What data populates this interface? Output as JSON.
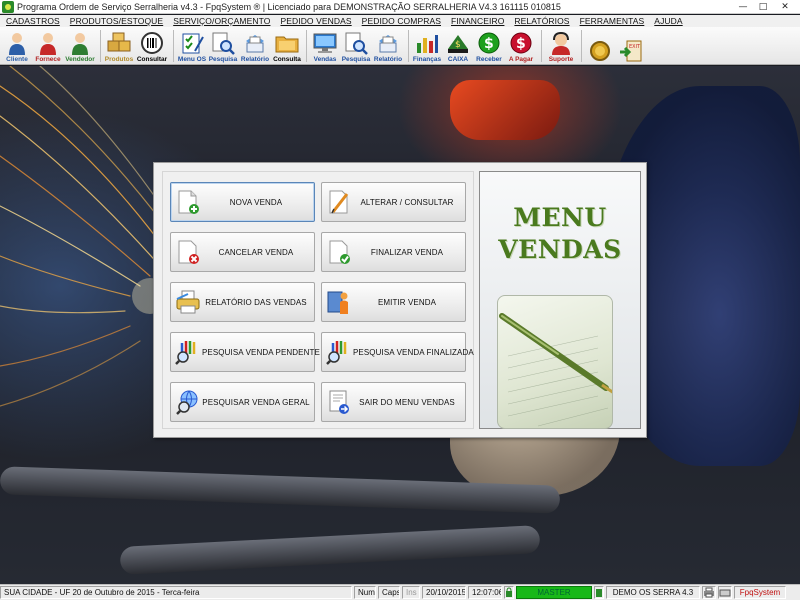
{
  "window": {
    "title": "Programa Ordem de Serviço Serralheria v4.3 - FpqSystem ® | Licenciado para  DEMONSTRAÇÃO SERRALHERIA V4.3 161115 010815",
    "minimize": "—",
    "maximize": "□",
    "close": "✕"
  },
  "menubar": {
    "items": [
      "CADASTROS",
      "PRODUTOS/ESTOQUE",
      "SERVIÇO/ORÇAMENTO",
      "PEDIDO VENDAS",
      "PEDIDO COMPRAS",
      "FINANCEIRO",
      "RELATÓRIOS",
      "FERRAMENTAS",
      "AJUDA"
    ]
  },
  "toolbar": {
    "items": [
      {
        "label": "Cliente",
        "icon": "person-icon",
        "color": "#2d5fa8"
      },
      {
        "label": "Fornece",
        "icon": "person-red-icon",
        "color": "#b22222"
      },
      {
        "label": "Vendedor",
        "icon": "person-green-icon",
        "color": "#2e7d32"
      },
      {
        "label": "Produtos",
        "icon": "boxes-icon",
        "color": "#c8a040"
      },
      {
        "label": "Consultar",
        "icon": "barcode-icon",
        "color": "#000000"
      },
      {
        "label": "Menu OS",
        "icon": "checklist-icon",
        "color": "#1f4fa0"
      },
      {
        "label": "Pesquisa",
        "icon": "search-doc-icon",
        "color": "#1f4fa0"
      },
      {
        "label": "Relatório",
        "icon": "report-icon",
        "color": "#1f4fa0"
      },
      {
        "label": "Consulta",
        "icon": "folder-icon",
        "color": "#000000"
      },
      {
        "label": "Vendas",
        "icon": "monitor-icon",
        "color": "#1f4fa0"
      },
      {
        "label": "Pesquisa",
        "icon": "search-doc-icon",
        "color": "#1f4fa0"
      },
      {
        "label": "Relatório",
        "icon": "report-icon",
        "color": "#1f4fa0"
      },
      {
        "label": "Finanças",
        "icon": "chart-icon",
        "color": "#1f4fa0"
      },
      {
        "label": "CAIXA",
        "icon": "cashbox-icon",
        "color": "#1f4fa0"
      },
      {
        "label": "Receber",
        "icon": "dollar-green-icon",
        "color": "#1f4fa0"
      },
      {
        "label": "A Pagar",
        "icon": "dollar-red-icon",
        "color": "#b22222"
      },
      {
        "label": "Suporte",
        "icon": "support-icon",
        "color": "#b22222"
      },
      {
        "label": "",
        "icon": "coin-icon",
        "color": "#000000"
      },
      {
        "label": "",
        "icon": "exit-icon",
        "color": "#000000"
      }
    ]
  },
  "panel": {
    "heading_line1": "MENU",
    "heading_line2": "VENDAS",
    "buttons": [
      {
        "label": "NOVA VENDA",
        "icon": "new-doc-icon"
      },
      {
        "label": "ALTERAR / CONSULTAR",
        "icon": "edit-doc-icon"
      },
      {
        "label": "CANCELAR VENDA",
        "icon": "cancel-doc-icon"
      },
      {
        "label": "FINALIZAR VENDA",
        "icon": "check-doc-icon"
      },
      {
        "label": "RELATÓRIO DAS VENDAS",
        "icon": "printer-icon"
      },
      {
        "label": "EMITIR VENDA",
        "icon": "emit-icon"
      },
      {
        "label": "PESQUISA VENDA PENDENTE",
        "icon": "search-pencils-icon"
      },
      {
        "label": "PESQUISA VENDA FINALIZADA",
        "icon": "search-pencils-icon"
      },
      {
        "label": "PESQUISAR VENDA GERAL",
        "icon": "search-globe-icon"
      },
      {
        "label": "SAIR DO MENU VENDAS",
        "icon": "exit-doc-icon"
      }
    ]
  },
  "statusbar": {
    "city": "SUA CIDADE - UF 20 de Outubro de 2015 - Terca-feira",
    "num": "Num",
    "caps": "Caps",
    "ins": "Ins",
    "date": "20/10/2015",
    "time": "12:07:06",
    "master": "MASTER",
    "demo": "DEMO OS SERRA 4.3",
    "brand": "FpqSystem"
  }
}
